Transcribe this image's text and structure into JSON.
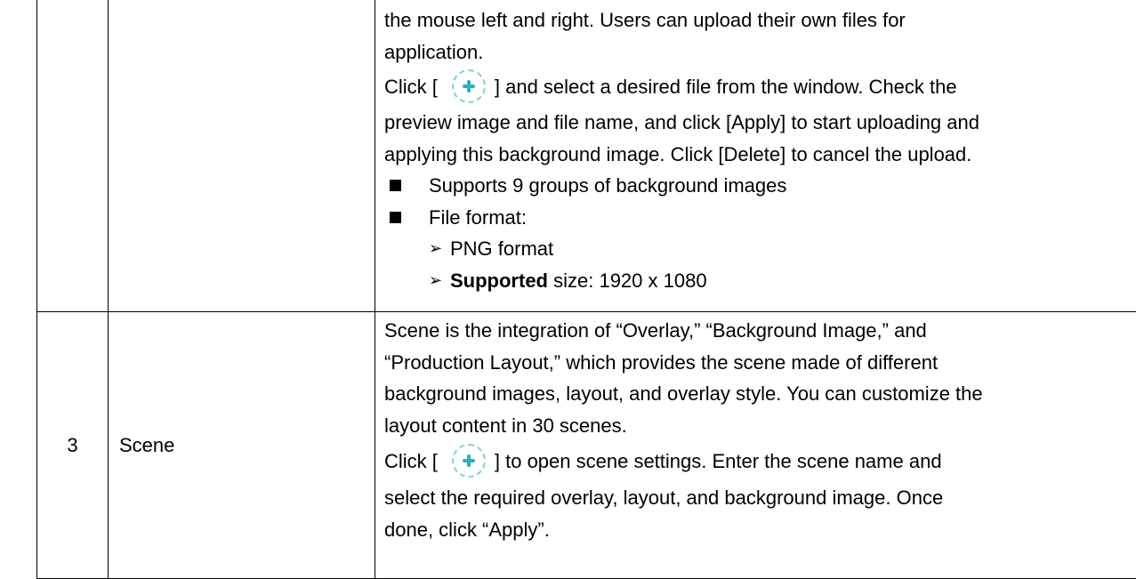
{
  "row1": {
    "line1": "the mouse left and right. Users can upload their own files for",
    "line2": "application.",
    "click_pre": "Click [",
    "click_post": "] and select a desired file from the window. Check the",
    "line4": "preview image and file name, and click [Apply] to start uploading and",
    "line5": "applying this background image. Click [Delete] to cancel the upload.",
    "bullets": {
      "b1": "Supports 9 groups of background images",
      "b2": "File format:"
    },
    "sub_bullets": {
      "s1": "PNG format",
      "s2_bold": "Supported",
      "s2_rest": " size: 1920 x 1080"
    },
    "icon": "plus-circle-icon"
  },
  "row2": {
    "number": "3",
    "name": "Scene",
    "line1": "Scene is the integration of “Overlay,” “Background Image,” and",
    "line2": "“Production Layout,” which provides the scene made of different",
    "line3": "background images, layout, and overlay style. You can customize the",
    "line4": "layout content in 30 scenes.",
    "click_pre": "Click [",
    "click_post": "] to open scene settings. Enter the scene name and",
    "line6": "select the required overlay, layout, and background image. Once",
    "line7": "done, click “Apply”.",
    "icon": "plus-circle-icon"
  },
  "colors": {
    "icon_accent": "#22b3c4",
    "icon_ring": "#7fd0d4"
  }
}
